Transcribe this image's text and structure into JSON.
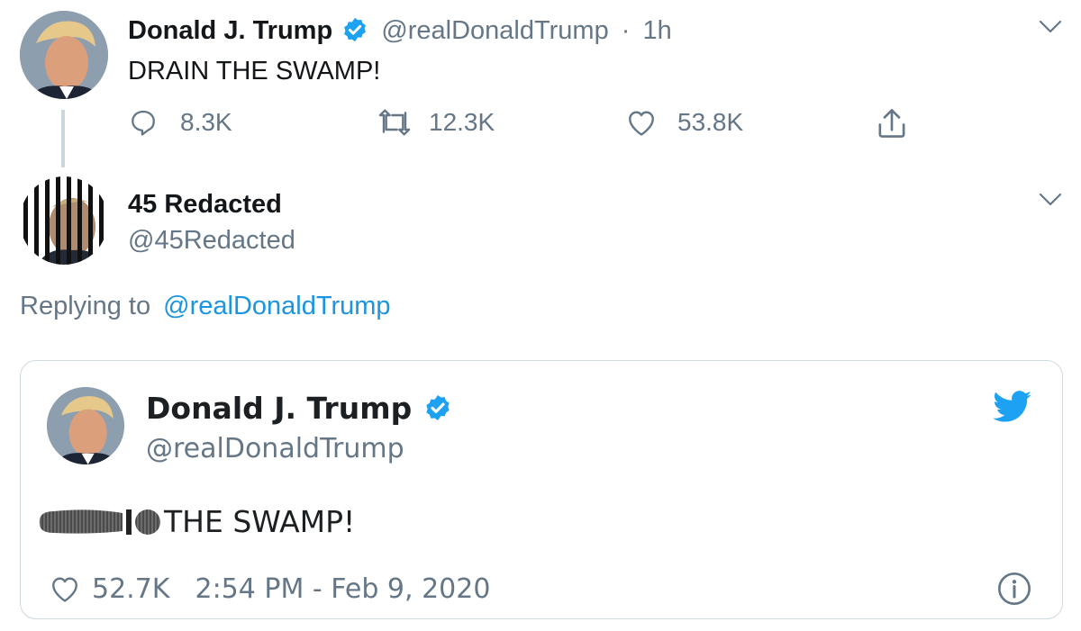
{
  "tweet": {
    "author_name": "Donald J. Trump",
    "handle": "@realDonaldTrump",
    "time_sep": "·",
    "time": "1h",
    "text": "DRAIN THE SWAMP!",
    "actions": {
      "replies": "8.3K",
      "retweets": "12.3K",
      "likes": "53.8K"
    }
  },
  "reply": {
    "author_name": "45 Redacted",
    "handle": "@45Redacted",
    "replying_prefix": "Replying to",
    "replying_handle": "@realDonaldTrump"
  },
  "embedded": {
    "author_name": "Donald J. Trump",
    "handle": "@realDonaldTrump",
    "text": "THE SWAMP!",
    "likes": "52.7K",
    "timestamp": "2:54 PM - Feb 9, 2020"
  },
  "colors": {
    "verified": "#1da1f2",
    "link": "#1b95e0",
    "muted": "#657786"
  }
}
